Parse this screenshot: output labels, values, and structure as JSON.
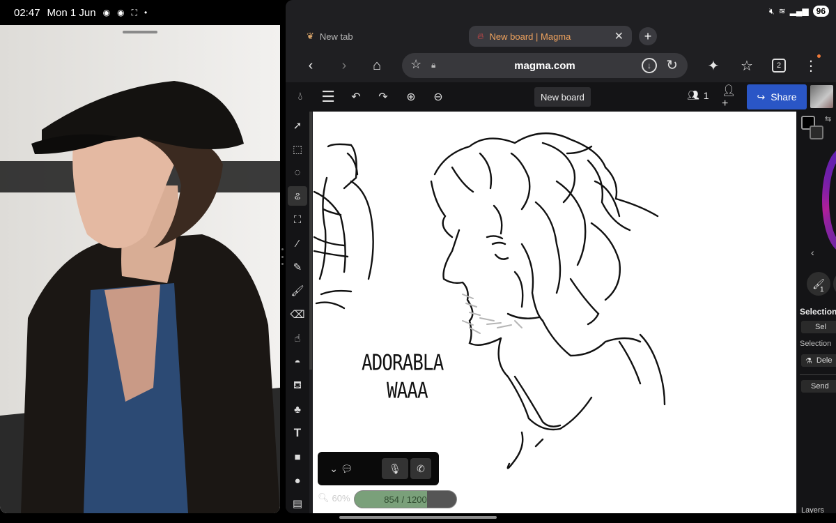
{
  "status_bar": {
    "time": "02:47",
    "date": "Mon 1 Jun",
    "battery": "96",
    "icons": [
      "discord-icon",
      "discord-icon",
      "screenshot-icon",
      "mute-icon",
      "wifi-icon",
      "signal-icon"
    ]
  },
  "browser": {
    "tabs": [
      {
        "label": "New tab",
        "active": false
      },
      {
        "label": "New board | Magma",
        "active": true
      }
    ],
    "url": "magma.com",
    "tab_count": "2"
  },
  "magma": {
    "board_name": "New board",
    "user_count": "1",
    "share_label": "Share",
    "tools": [
      "move",
      "rect-select",
      "ellipse-select",
      "lasso",
      "transform",
      "eyedropper",
      "pencil",
      "brush",
      "eraser",
      "smudge",
      "blur",
      "fill",
      "shape-brush",
      "text",
      "rectangle",
      "ellipse",
      "frames"
    ],
    "active_tool": "lasso",
    "canvas_text": [
      "ADORABLA",
      "WAAA"
    ],
    "zoom": "60%",
    "counter": {
      "text": "854 / 1200",
      "value": 854,
      "max": 1200
    },
    "right_panel": {
      "brush_count": "1",
      "selection_heading": "Selection",
      "select_label": "Sel",
      "selection_sub": "Selection",
      "delete_label": "Dele",
      "send_label": "Send",
      "layers_label": "Layers"
    }
  }
}
